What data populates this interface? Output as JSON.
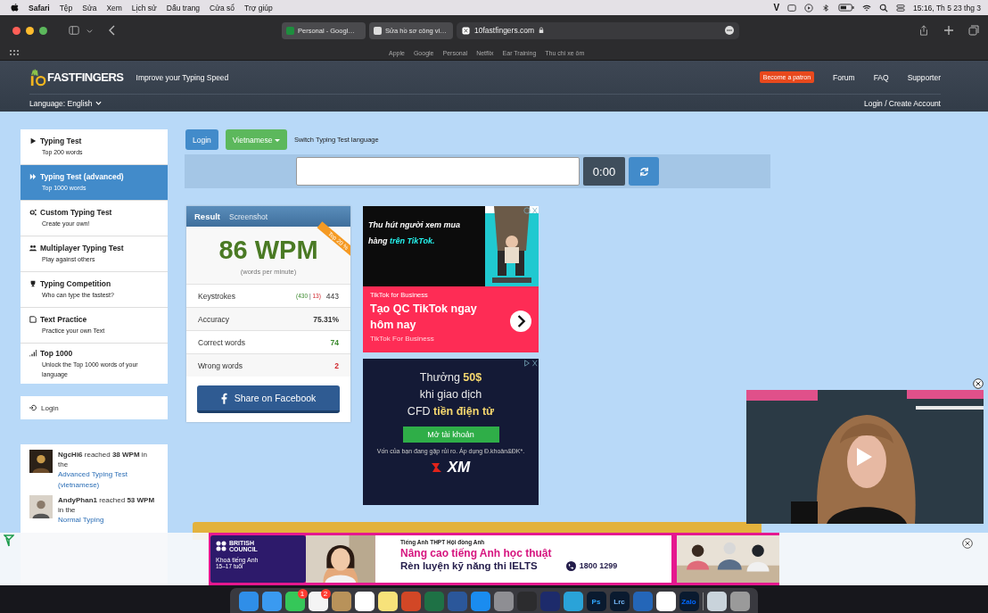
{
  "menubar": {
    "app": "Safari",
    "menus": [
      "Tệp",
      "Sửa",
      "Xem",
      "Lịch sử",
      "Dấu trang",
      "Cửa sổ",
      "Trợ giúp"
    ],
    "status_letter": "V",
    "clock": "15:16, Th 5 23 thg 3"
  },
  "browser": {
    "tabs": [
      {
        "title": "Personal - Googl…",
        "selected": false
      },
      {
        "title": "Sửa hồ sơ công vi…",
        "selected": false
      }
    ],
    "address": "10fastfingers.com",
    "favorites": [
      "Apple",
      "Google",
      "Personal",
      "Netflix",
      "Ear Training",
      "Thu chi xe ôm"
    ]
  },
  "site": {
    "logo": "FASTFINGERS",
    "tagline": "Improve your Typing Speed",
    "patron": "Become a patron",
    "nav": [
      "Forum",
      "FAQ",
      "Supporter"
    ],
    "language": "Language: English",
    "account": "Login / Create Account"
  },
  "sidebar": {
    "items": [
      {
        "kind": "play",
        "title": "Typing Test",
        "subtitle": "Top 200 words",
        "selected": false
      },
      {
        "kind": "forward",
        "title": "Typing Test (advanced)",
        "subtitle": "Top 1000 words",
        "selected": true
      },
      {
        "kind": "gear",
        "title": "Custom Typing Test",
        "subtitle": "Create your own!",
        "selected": false
      },
      {
        "kind": "users",
        "title": "Multiplayer Typing Test",
        "subtitle": "Play against others",
        "selected": false
      },
      {
        "kind": "trophy",
        "title": "Typing Competition",
        "subtitle": "Who can type the fastest?",
        "selected": false
      },
      {
        "kind": "doc",
        "title": "Text Practice",
        "subtitle": "Practice your own Text",
        "selected": false
      },
      {
        "kind": "bars",
        "title": "Top 1000",
        "subtitle": "Unlock the Top 1000 words of your language",
        "selected": false
      }
    ],
    "login": "Login"
  },
  "feed": [
    {
      "user": "NgcHi6",
      "verb": "reached",
      "wpm": "38 WPM",
      "pre": "in the",
      "link": "Advanced Typing Test (vietnamese)"
    },
    {
      "user": "AndyPhan1",
      "verb": "reached",
      "wpm": "53 WPM",
      "pre": "in the",
      "link": "Normal Typing"
    }
  ],
  "typing": {
    "login": "Login",
    "language": "Vietnamese",
    "switch": "Switch Typing Test language",
    "timer": "0:00"
  },
  "result": {
    "tabs": [
      {
        "label": "Result",
        "selected": true
      },
      {
        "label": "Screenshot",
        "selected": false
      }
    ],
    "ribbon": "Top 20 %",
    "wpm": "86 WPM",
    "unit": "(words per minute)",
    "rows": [
      {
        "label": "Keystrokes",
        "kind": "split",
        "correct": "(430",
        "sep": "|",
        "wrong": "13)",
        "value": "443"
      },
      {
        "label": "Accuracy",
        "kind": "bold",
        "value": "75.31%"
      },
      {
        "label": "Correct words",
        "kind": "good",
        "value": "74"
      },
      {
        "label": "Wrong words",
        "kind": "bad",
        "value": "2"
      }
    ],
    "share": "Share on Facebook"
  },
  "ads": {
    "tiktok": {
      "headline": "Thu hút người xem mua hàng",
      "highlight": "trên TikTok.",
      "brand": "TikTok for Business",
      "title": "Tạo QC TikTok ngay hôm nay",
      "sponsor": "TikTok For Business"
    },
    "xm": {
      "lines": [
        "Thưởng **50$**",
        "khi giao dịch",
        "CFD **tiền điện tử**"
      ],
      "button": "Mở tài khoản",
      "disclaimer": "Vốn của bạn đang gặp rủi ro. Áp dụng Đ.khoản&ĐK*.",
      "logo": "XM"
    },
    "banner": {
      "brand": "BRITISH COUNCIL",
      "course": "Khoá tiếng Anh",
      "age": "15–17 tuổi",
      "kicker": "Tiếng Anh THPT Hội đồng Anh",
      "line1": "Nâng cao tiếng Anh học thuật",
      "line2": "Rèn luyện kỹ năng thi IELTS",
      "phone": "1800 1299"
    }
  },
  "dock": [
    {
      "kind": "finder"
    },
    {
      "kind": "safari"
    },
    {
      "kind": "messages",
      "badge": "1"
    },
    {
      "kind": "photos",
      "badge": "2"
    },
    {
      "kind": "box"
    },
    {
      "kind": "list"
    },
    {
      "kind": "notes"
    },
    {
      "kind": "powerpoint"
    },
    {
      "kind": "excel"
    },
    {
      "kind": "word"
    },
    {
      "kind": "appstore"
    },
    {
      "kind": "settings"
    },
    {
      "kind": "film"
    },
    {
      "kind": "triangle"
    },
    {
      "kind": "edge"
    },
    {
      "kind": "label",
      "label": "Ps"
    },
    {
      "kind": "label",
      "label": "Lrc"
    },
    {
      "kind": "toolbox"
    },
    {
      "kind": "swirl"
    },
    {
      "kind": "label",
      "label": "Zalo"
    },
    {
      "kind": "sep"
    },
    {
      "kind": "preview"
    },
    {
      "kind": "trash"
    }
  ]
}
